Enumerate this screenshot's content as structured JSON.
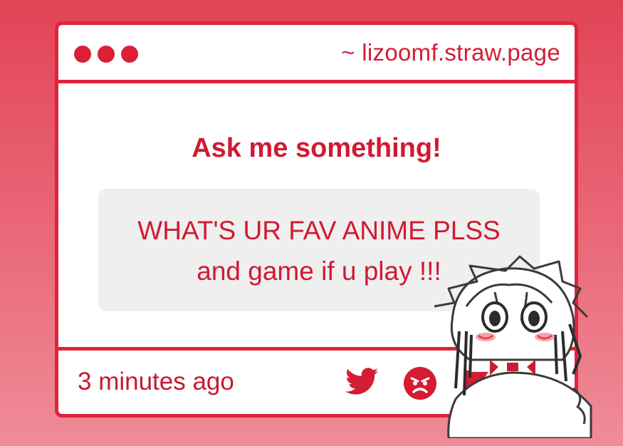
{
  "window": {
    "url": "~ lizoomf.straw.page"
  },
  "main": {
    "heading": "Ask me something!",
    "question_line1": "WHAT'S UR FAV ANIME PLSS",
    "question_line2": "and game if u play !!!"
  },
  "footer": {
    "timestamp": "3 minutes ago",
    "icons": [
      "twitter-icon",
      "angry-face-icon",
      "flag-icon"
    ]
  },
  "colors": {
    "accent": "#e0243a",
    "text": "#cf1a31",
    "question_bg": "#efefef",
    "background_top": "#e24356",
    "background_bottom": "#ef8c98"
  }
}
